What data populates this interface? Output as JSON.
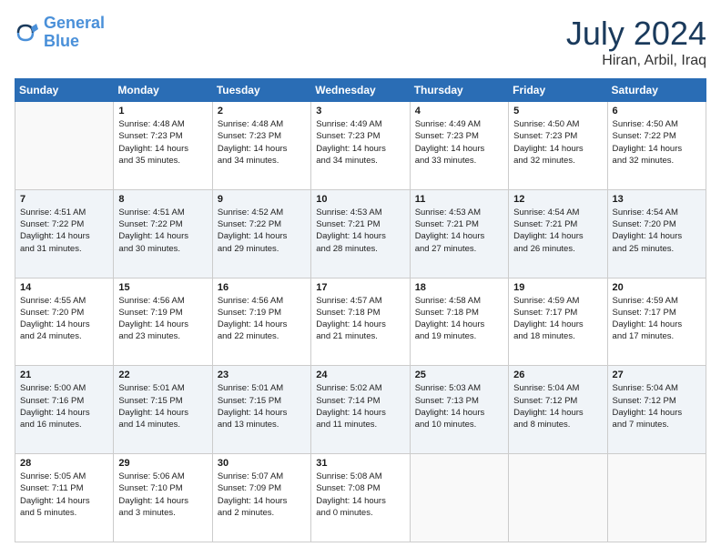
{
  "header": {
    "logo_line1": "General",
    "logo_line2": "Blue",
    "month": "July 2024",
    "location": "Hiran, Arbil, Iraq"
  },
  "weekdays": [
    "Sunday",
    "Monday",
    "Tuesday",
    "Wednesday",
    "Thursday",
    "Friday",
    "Saturday"
  ],
  "weeks": [
    [
      {
        "day": "",
        "info": ""
      },
      {
        "day": "1",
        "info": "Sunrise: 4:48 AM\nSunset: 7:23 PM\nDaylight: 14 hours\nand 35 minutes."
      },
      {
        "day": "2",
        "info": "Sunrise: 4:48 AM\nSunset: 7:23 PM\nDaylight: 14 hours\nand 34 minutes."
      },
      {
        "day": "3",
        "info": "Sunrise: 4:49 AM\nSunset: 7:23 PM\nDaylight: 14 hours\nand 34 minutes."
      },
      {
        "day": "4",
        "info": "Sunrise: 4:49 AM\nSunset: 7:23 PM\nDaylight: 14 hours\nand 33 minutes."
      },
      {
        "day": "5",
        "info": "Sunrise: 4:50 AM\nSunset: 7:23 PM\nDaylight: 14 hours\nand 32 minutes."
      },
      {
        "day": "6",
        "info": "Sunrise: 4:50 AM\nSunset: 7:22 PM\nDaylight: 14 hours\nand 32 minutes."
      }
    ],
    [
      {
        "day": "7",
        "info": "Sunrise: 4:51 AM\nSunset: 7:22 PM\nDaylight: 14 hours\nand 31 minutes."
      },
      {
        "day": "8",
        "info": "Sunrise: 4:51 AM\nSunset: 7:22 PM\nDaylight: 14 hours\nand 30 minutes."
      },
      {
        "day": "9",
        "info": "Sunrise: 4:52 AM\nSunset: 7:22 PM\nDaylight: 14 hours\nand 29 minutes."
      },
      {
        "day": "10",
        "info": "Sunrise: 4:53 AM\nSunset: 7:21 PM\nDaylight: 14 hours\nand 28 minutes."
      },
      {
        "day": "11",
        "info": "Sunrise: 4:53 AM\nSunset: 7:21 PM\nDaylight: 14 hours\nand 27 minutes."
      },
      {
        "day": "12",
        "info": "Sunrise: 4:54 AM\nSunset: 7:21 PM\nDaylight: 14 hours\nand 26 minutes."
      },
      {
        "day": "13",
        "info": "Sunrise: 4:54 AM\nSunset: 7:20 PM\nDaylight: 14 hours\nand 25 minutes."
      }
    ],
    [
      {
        "day": "14",
        "info": "Sunrise: 4:55 AM\nSunset: 7:20 PM\nDaylight: 14 hours\nand 24 minutes."
      },
      {
        "day": "15",
        "info": "Sunrise: 4:56 AM\nSunset: 7:19 PM\nDaylight: 14 hours\nand 23 minutes."
      },
      {
        "day": "16",
        "info": "Sunrise: 4:56 AM\nSunset: 7:19 PM\nDaylight: 14 hours\nand 22 minutes."
      },
      {
        "day": "17",
        "info": "Sunrise: 4:57 AM\nSunset: 7:18 PM\nDaylight: 14 hours\nand 21 minutes."
      },
      {
        "day": "18",
        "info": "Sunrise: 4:58 AM\nSunset: 7:18 PM\nDaylight: 14 hours\nand 19 minutes."
      },
      {
        "day": "19",
        "info": "Sunrise: 4:59 AM\nSunset: 7:17 PM\nDaylight: 14 hours\nand 18 minutes."
      },
      {
        "day": "20",
        "info": "Sunrise: 4:59 AM\nSunset: 7:17 PM\nDaylight: 14 hours\nand 17 minutes."
      }
    ],
    [
      {
        "day": "21",
        "info": "Sunrise: 5:00 AM\nSunset: 7:16 PM\nDaylight: 14 hours\nand 16 minutes."
      },
      {
        "day": "22",
        "info": "Sunrise: 5:01 AM\nSunset: 7:15 PM\nDaylight: 14 hours\nand 14 minutes."
      },
      {
        "day": "23",
        "info": "Sunrise: 5:01 AM\nSunset: 7:15 PM\nDaylight: 14 hours\nand 13 minutes."
      },
      {
        "day": "24",
        "info": "Sunrise: 5:02 AM\nSunset: 7:14 PM\nDaylight: 14 hours\nand 11 minutes."
      },
      {
        "day": "25",
        "info": "Sunrise: 5:03 AM\nSunset: 7:13 PM\nDaylight: 14 hours\nand 10 minutes."
      },
      {
        "day": "26",
        "info": "Sunrise: 5:04 AM\nSunset: 7:12 PM\nDaylight: 14 hours\nand 8 minutes."
      },
      {
        "day": "27",
        "info": "Sunrise: 5:04 AM\nSunset: 7:12 PM\nDaylight: 14 hours\nand 7 minutes."
      }
    ],
    [
      {
        "day": "28",
        "info": "Sunrise: 5:05 AM\nSunset: 7:11 PM\nDaylight: 14 hours\nand 5 minutes."
      },
      {
        "day": "29",
        "info": "Sunrise: 5:06 AM\nSunset: 7:10 PM\nDaylight: 14 hours\nand 3 minutes."
      },
      {
        "day": "30",
        "info": "Sunrise: 5:07 AM\nSunset: 7:09 PM\nDaylight: 14 hours\nand 2 minutes."
      },
      {
        "day": "31",
        "info": "Sunrise: 5:08 AM\nSunset: 7:08 PM\nDaylight: 14 hours\nand 0 minutes."
      },
      {
        "day": "",
        "info": ""
      },
      {
        "day": "",
        "info": ""
      },
      {
        "day": "",
        "info": ""
      }
    ]
  ]
}
